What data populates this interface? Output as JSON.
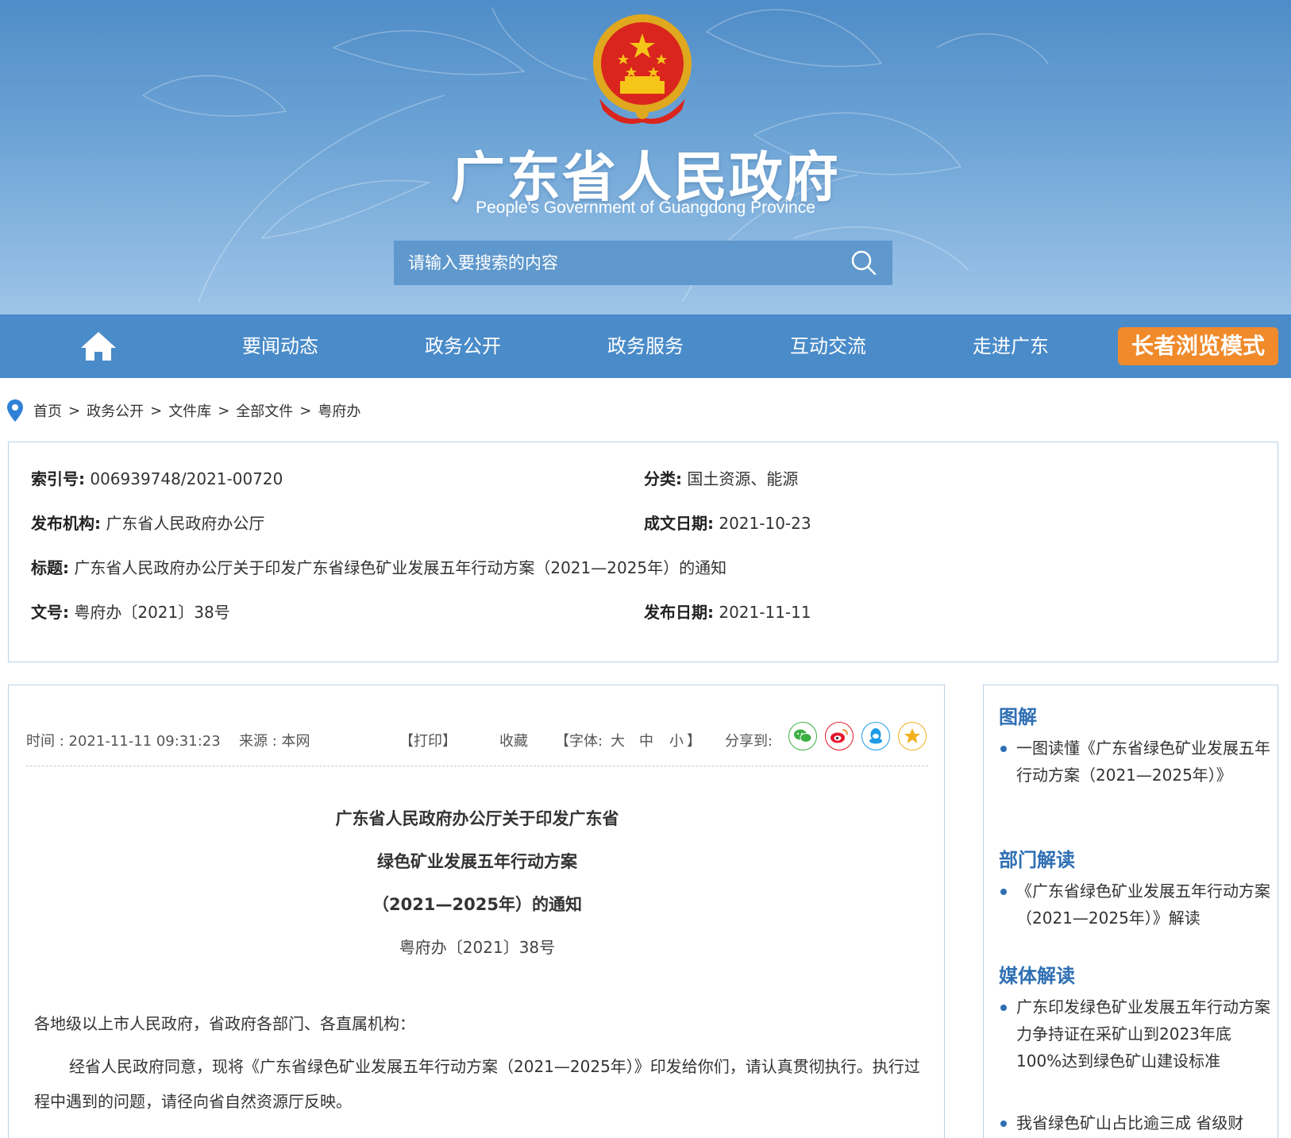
{
  "header": {
    "title": "广东省人民政府",
    "subtitle": "People's Government of Guangdong Province",
    "search_placeholder": "请输入要搜索的内容"
  },
  "nav": {
    "items": [
      "要闻动态",
      "政务公开",
      "政务服务",
      "互动交流",
      "走进广东"
    ],
    "elder_mode": "长者浏览模式"
  },
  "breadcrumb": {
    "items": [
      "首页",
      "政务公开",
      "文件库",
      "全部文件",
      "粤府办"
    ],
    "separator": ">"
  },
  "meta": {
    "index_label": "索引号:",
    "index_value": "006939748/2021-00720",
    "category_label": "分类:",
    "category_value": "国土资源、能源",
    "publisher_label": "发布机构:",
    "publisher_value": "广东省人民政府办公厅",
    "written_date_label": "成文日期:",
    "written_date_value": "2021-10-23",
    "title_label": "标题:",
    "title_value": "广东省人民政府办公厅关于印发广东省绿色矿业发展五年行动方案（2021—2025年）的通知",
    "doc_no_label": "文号:",
    "doc_no_value": "粤府办〔2021〕38号",
    "publish_date_label": "发布日期:",
    "publish_date_value": "2021-11-11"
  },
  "toolbar": {
    "time": "时间 : 2021-11-11 09:31:23",
    "source": "来源 : 本网",
    "print": "【打印】",
    "favorite": "收藏",
    "font_prefix": "【字体:",
    "font_large": "大",
    "font_medium": "中",
    "font_small": "小",
    "font_suffix": "】",
    "share_label": "分享到:",
    "share_icons": [
      "wechat-icon",
      "weibo-icon",
      "qq-icon",
      "qzone-icon"
    ]
  },
  "article": {
    "title_line1": "广东省人民政府办公厅关于印发广东省",
    "title_line2": "绿色矿业发展五年行动方案",
    "title_line3": "（2021—2025年）的通知",
    "doc_no": "粤府办〔2021〕38号",
    "salutation": "各地级以上市人民政府，省政府各部门、各直属机构：",
    "body": "经省人民政府同意，现将《广东省绿色矿业发展五年行动方案（2021—2025年）》印发给你们，请认真贯彻执行。执行过程中遇到的问题，请径向省自然资源厅反映。"
  },
  "sidebar": {
    "sections": [
      {
        "heading": "图解",
        "items": [
          "一图读懂《广东省绿色矿业发展五年行动方案（2021—2025年）》"
        ]
      },
      {
        "heading": "部门解读",
        "items": [
          "《广东省绿色矿业发展五年行动方案（2021—2025年）》解读"
        ]
      },
      {
        "heading": "媒体解读",
        "items": [
          "广东印发绿色矿业发展五年行动方案 力争持证在采矿山到2023年底100%达到绿色矿山建设标准",
          "我省绿色矿山占比逾三成 省级财"
        ]
      }
    ]
  },
  "colors": {
    "banner_top": "#4f8cc7",
    "nav_bg": "#4a8bc9",
    "elder_btn": "#f08a2b",
    "accent_blue": "#2f6fb3",
    "box_border": "#b9d3ea"
  }
}
